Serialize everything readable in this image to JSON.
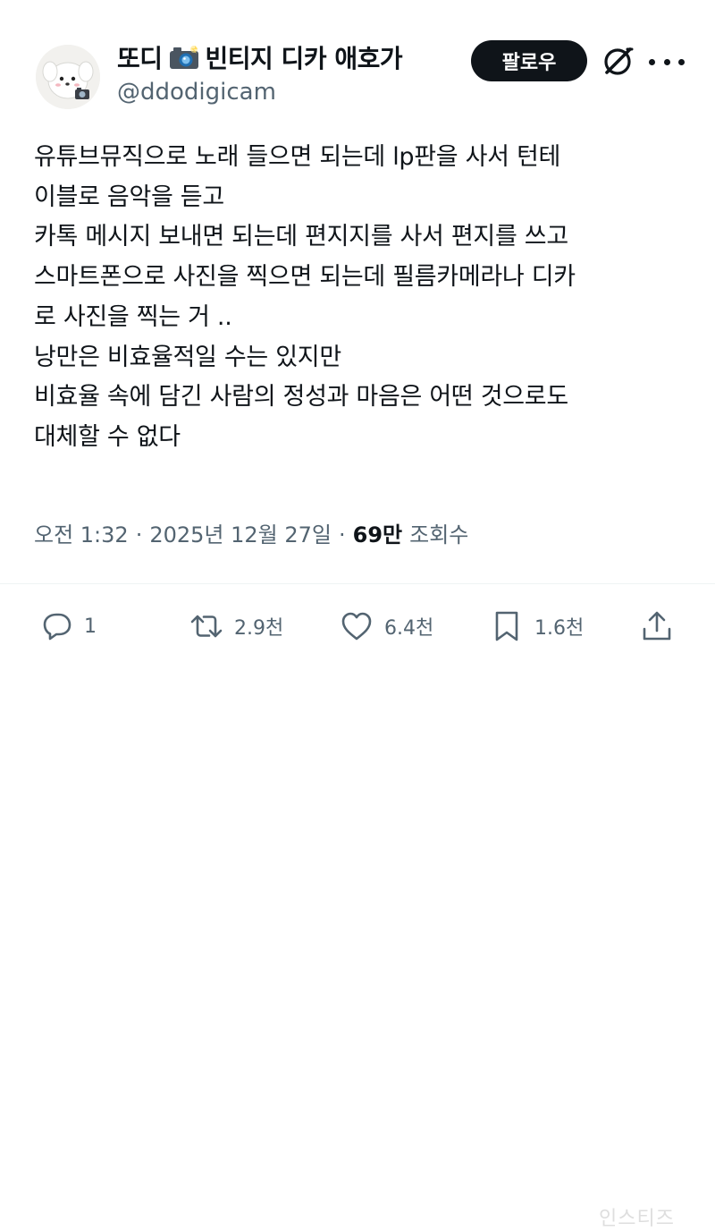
{
  "author": {
    "display_name_part1": "또디",
    "display_name_part2": "빈티지 디카 애호가",
    "handle": "@ddodigicam",
    "avatar_icon": "cartoon-dog-with-camera-avatar",
    "name_emoji_icon": "camera-with-flash-icon"
  },
  "header": {
    "follow_label": "팔로우",
    "grok_icon": "grok-icon",
    "more_icon": "more-dots-icon"
  },
  "post": {
    "lines": [
      "유튜브뮤직으로 노래 들으면 되는데 lp판을 사서 턴테",
      "이블로 음악을 듣고",
      "카톡 메시지 보내면 되는데 편지지를 사서 편지를 쓰고",
      "스마트폰으로 사진을 찍으면 되는데 필름카메라나 디카",
      "로 사진을 찍는 거 ..",
      "낭만은 비효율적일 수는 있지만",
      "비효율 속에 담긴 사람의 정성과 마음은 어떤 것으로도",
      "대체할 수 없다"
    ]
  },
  "meta": {
    "time": "오전 1:32",
    "separator": "·",
    "date": "2025년 12월 27일",
    "views_count": "69만",
    "views_label": "조회수"
  },
  "actions": {
    "reply_count": "1",
    "repost_count": "2.9천",
    "like_count": "6.4천",
    "bookmark_count": "1.6천",
    "reply_icon": "reply-bubble-icon",
    "repost_icon": "repost-arrows-icon",
    "like_icon": "heart-icon",
    "bookmark_icon": "bookmark-icon",
    "share_icon": "share-upload-icon"
  },
  "watermark": "인스티즈",
  "colors": {
    "text": "#0f1419",
    "secondary": "#536471",
    "follow_bg": "#0f1419",
    "follow_text": "#ffffff"
  }
}
